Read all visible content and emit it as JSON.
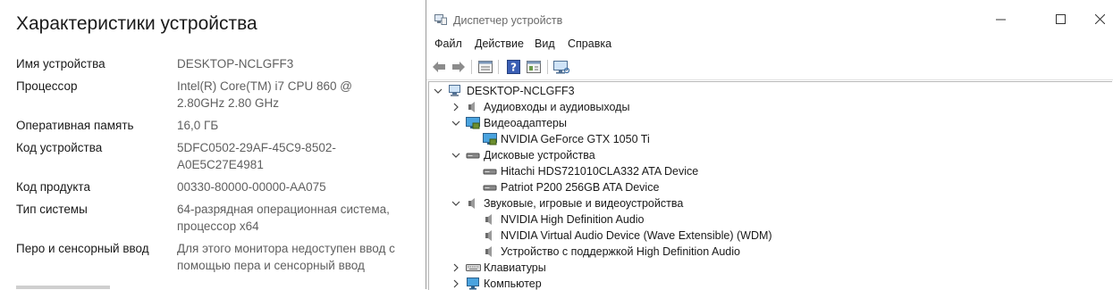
{
  "settings": {
    "title": "Характеристики устройства",
    "specs": [
      {
        "label": "Имя устройства",
        "value": "DESKTOP-NCLGFF3"
      },
      {
        "label": "Процессор",
        "value": "Intel(R) Core(TM) i7 CPU         860  @\n2.80GHz   2.80 GHz"
      },
      {
        "label": "Оперативная память",
        "value": "16,0 ГБ"
      },
      {
        "label": "Код устройства",
        "value": "5DFC0502-29AF-45C9-8502-\nA0E5C27E4981"
      },
      {
        "label": "Код продукта",
        "value": "00330-80000-00000-AA075"
      },
      {
        "label": "Тип системы",
        "value": "64-разрядная операционная система,\nпроцессор x64"
      },
      {
        "label": "Перо и сенсорный ввод",
        "value": "Для этого монитора недоступен ввод с\nпомощью пера и сенсорный ввод"
      }
    ]
  },
  "device_manager": {
    "title": "Диспетчер устройств",
    "menu": [
      "Файл",
      "Действие",
      "Вид",
      "Справка"
    ],
    "toolbar": [
      "back-icon",
      "forward-icon",
      "properties-icon",
      "help-icon",
      "view-icon",
      "monitor-scan-icon"
    ],
    "tree": {
      "root": "DESKTOP-NCLGFF3",
      "items": [
        {
          "label": "Аудиовходы и аудиовыходы",
          "expanded": false,
          "icon": "audio-io-icon"
        },
        {
          "label": "Видеоадаптеры",
          "expanded": true,
          "icon": "display-adapter-icon",
          "children": [
            {
              "label": "NVIDIA GeForce GTX 1050 Ti",
              "icon": "display-adapter-icon"
            }
          ]
        },
        {
          "label": "Дисковые устройства",
          "expanded": true,
          "icon": "disk-drive-icon",
          "children": [
            {
              "label": "Hitachi HDS721010CLA332 ATA Device",
              "icon": "disk-drive-icon"
            },
            {
              "label": "Patriot P200 256GB ATA Device",
              "icon": "disk-drive-icon"
            }
          ]
        },
        {
          "label": "Звуковые, игровые и видеоустройства",
          "expanded": true,
          "icon": "speaker-icon",
          "children": [
            {
              "label": "NVIDIA High Definition Audio",
              "icon": "speaker-icon"
            },
            {
              "label": "NVIDIA Virtual Audio Device (Wave Extensible) (WDM)",
              "icon": "speaker-icon"
            },
            {
              "label": "Устройство с поддержкой High Definition Audio",
              "icon": "speaker-icon"
            }
          ]
        },
        {
          "label": "Клавиатуры",
          "expanded": false,
          "icon": "keyboard-icon"
        },
        {
          "label": "Компьютер",
          "expanded": false,
          "icon": "computer-icon"
        }
      ]
    }
  }
}
